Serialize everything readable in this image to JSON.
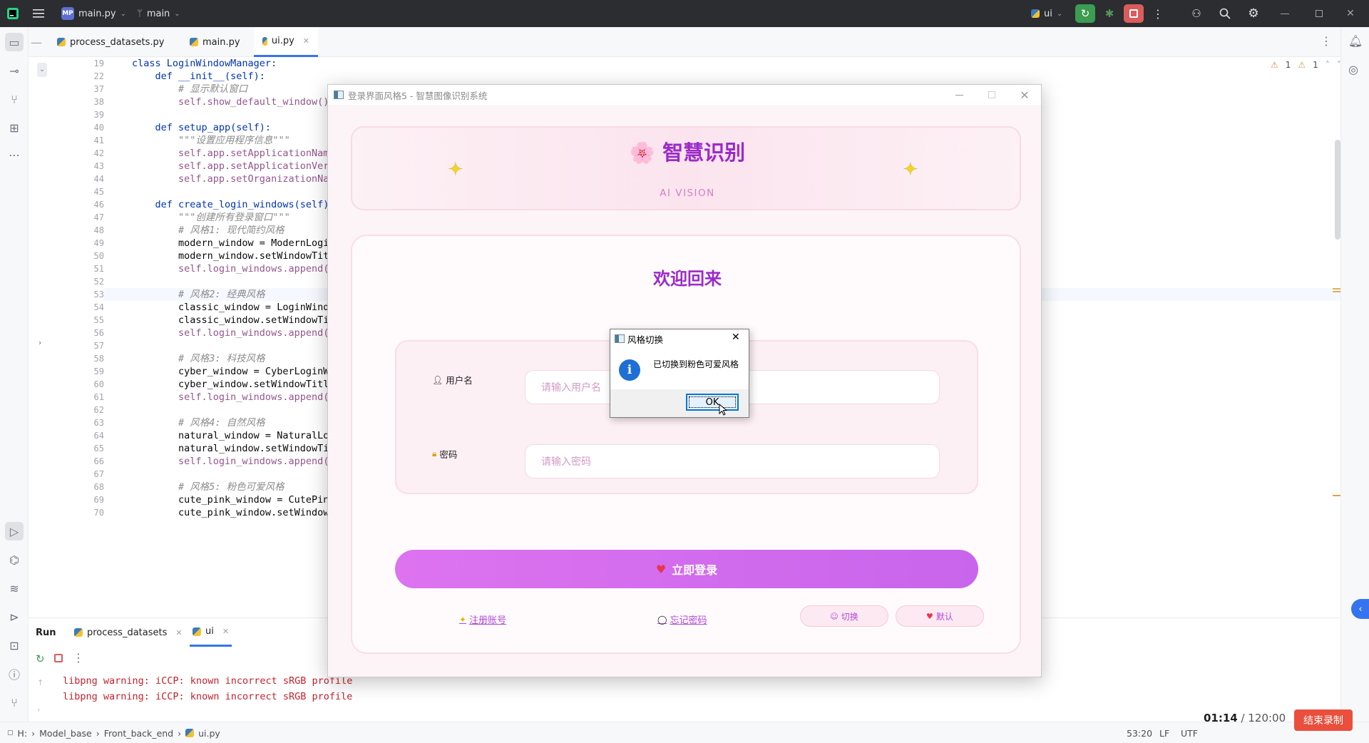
{
  "titlebar": {
    "project_badge": "MP",
    "project": "main.py",
    "branch": "main",
    "run_config": "ui"
  },
  "editor_tabs": [
    {
      "label": "process_datasets.py"
    },
    {
      "label": "main.py"
    },
    {
      "label": "ui.py",
      "active": true
    }
  ],
  "inspections": {
    "warnings": "1",
    "weak_warnings": "1"
  },
  "code": {
    "lines": [
      {
        "n": "19",
        "text": "class LoginWindowManager:"
      },
      {
        "n": "22",
        "text": "    def __init__(self):"
      },
      {
        "n": "37",
        "text": "        # 显示默认窗口"
      },
      {
        "n": "38",
        "text": "        self.show_default_window()"
      },
      {
        "n": "39",
        "text": ""
      },
      {
        "n": "40",
        "text": "    def setup_app(self):"
      },
      {
        "n": "41",
        "text": "        \"\"\"设置应用程序信息\"\"\""
      },
      {
        "n": "42",
        "text": "        self.app.setApplicationName(\"智"
      },
      {
        "n": "43",
        "text": "        self.app.setApplicationVersion("
      },
      {
        "n": "44",
        "text": "        self.app.setOrganizationName(\"智"
      },
      {
        "n": "45",
        "text": ""
      },
      {
        "n": "46",
        "text": "    def create_login_windows(self):"
      },
      {
        "n": "47",
        "text": "        \"\"\"创建所有登录窗口\"\"\""
      },
      {
        "n": "48",
        "text": "        # 风格1: 现代简约风格"
      },
      {
        "n": "49",
        "text": "        modern_window = ModernLoginWind"
      },
      {
        "n": "50",
        "text": "        modern_window.setWindowTitle(\"登"
      },
      {
        "n": "51",
        "text": "        self.login_windows.append(moder"
      },
      {
        "n": "52",
        "text": ""
      },
      {
        "n": "53",
        "text": "        # 风格2: 经典风格"
      },
      {
        "n": "54",
        "text": "        classic_window = LoginWindow(se"
      },
      {
        "n": "55",
        "text": "        classic_window.setWindowTitle(\""
      },
      {
        "n": "56",
        "text": "        self.login_windows.append(class"
      },
      {
        "n": "57",
        "text": ""
      },
      {
        "n": "58",
        "text": "        # 风格3: 科技风格"
      },
      {
        "n": "59",
        "text": "        cyber_window = CyberLoginWindow"
      },
      {
        "n": "60",
        "text": "        cyber_window.setWindowTitle(\"登"
      },
      {
        "n": "61",
        "text": "        self.login_windows.append(cyber"
      },
      {
        "n": "62",
        "text": ""
      },
      {
        "n": "63",
        "text": "        # 风格4: 自然风格"
      },
      {
        "n": "64",
        "text": "        natural_window = NaturalLoginWi"
      },
      {
        "n": "65",
        "text": "        natural_window.setWindowTitle(\""
      },
      {
        "n": "66",
        "text": "        self.login_windows.append(natur"
      },
      {
        "n": "67",
        "text": ""
      },
      {
        "n": "68",
        "text": "        # 风格5: 粉色可爱风格"
      },
      {
        "n": "69",
        "text": "        cute_pink_window = CutePinkLogi"
      },
      {
        "n": "70",
        "text": "        cute_pink_window.setWindowTitle"
      }
    ]
  },
  "run_panel": {
    "label": "Run",
    "tabs": [
      {
        "label": "process_datasets"
      },
      {
        "label": "ui",
        "active": true
      }
    ],
    "console": [
      "libpng warning: iCCP: known incorrect sRGB profile",
      "libpng warning: iCCP: known incorrect sRGB profile"
    ]
  },
  "statusbar": {
    "drive": "H:",
    "crumbs": [
      "Model_base",
      "Front_back_end",
      "ui.py"
    ],
    "position": "53:20",
    "line_sep": "LF",
    "encoding": "UTF"
  },
  "recording": {
    "elapsed": "01:14",
    "total": "/ 120:00",
    "stop_label": "结束录制"
  },
  "login_window": {
    "title": "登录界面风格5 - 智慧图像识别系统",
    "app_title": "🌸 智慧识别",
    "app_subtitle": "AI VISION",
    "welcome": "欢迎回来",
    "username_label": "用户名",
    "username_placeholder": "请输入用户名",
    "password_label": "密码",
    "password_placeholder": "请输入密码",
    "login_button": "立即登录",
    "register_link": "注册账号",
    "forgot_link": "忘记密码",
    "switch_button": "切换",
    "default_button": "默认"
  },
  "message_box": {
    "title": "风格切换",
    "text": "已切换到粉色可爱风格",
    "ok": "OK"
  },
  "colors": {
    "accent": "#9b2ac9",
    "login_gradient_start": "#dd73ef",
    "stop_button": "#e94f3c"
  }
}
